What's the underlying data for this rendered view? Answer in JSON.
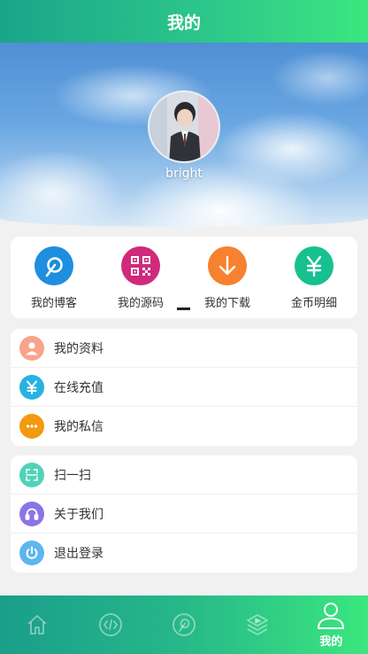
{
  "header": {
    "title": "我的"
  },
  "profile": {
    "username": "bright"
  },
  "quick_actions": [
    {
      "label": "我的博客",
      "icon": "blog-icon",
      "color": "#1e8ede"
    },
    {
      "label": "我的源码",
      "icon": "qrcode-icon",
      "color": "#d02a7c"
    },
    {
      "label": "我的下载",
      "icon": "download-icon",
      "color": "#f6812f"
    },
    {
      "label": "金币明细",
      "icon": "yen-icon",
      "color": "#18c08f"
    }
  ],
  "menu_group_1": [
    {
      "label": "我的资料",
      "icon": "user-icon",
      "color": "#f7a48b"
    },
    {
      "label": "在线充值",
      "icon": "yen-icon",
      "color": "#27b2e2"
    },
    {
      "label": "我的私信",
      "icon": "chat-icon",
      "color": "#f29a10"
    }
  ],
  "menu_group_2": [
    {
      "label": "扫一扫",
      "icon": "scan-icon",
      "color": "#4fd3b8"
    },
    {
      "label": "关于我们",
      "icon": "headset-icon",
      "color": "#8b74e6"
    },
    {
      "label": "退出登录",
      "icon": "power-icon",
      "color": "#5cb6f0"
    }
  ],
  "tabbar": {
    "tabs": [
      {
        "icon": "home-icon"
      },
      {
        "icon": "code-icon"
      },
      {
        "icon": "blog-icon"
      },
      {
        "icon": "layers-icon"
      },
      {
        "icon": "user-icon",
        "label": "我的",
        "active": true
      }
    ]
  }
}
